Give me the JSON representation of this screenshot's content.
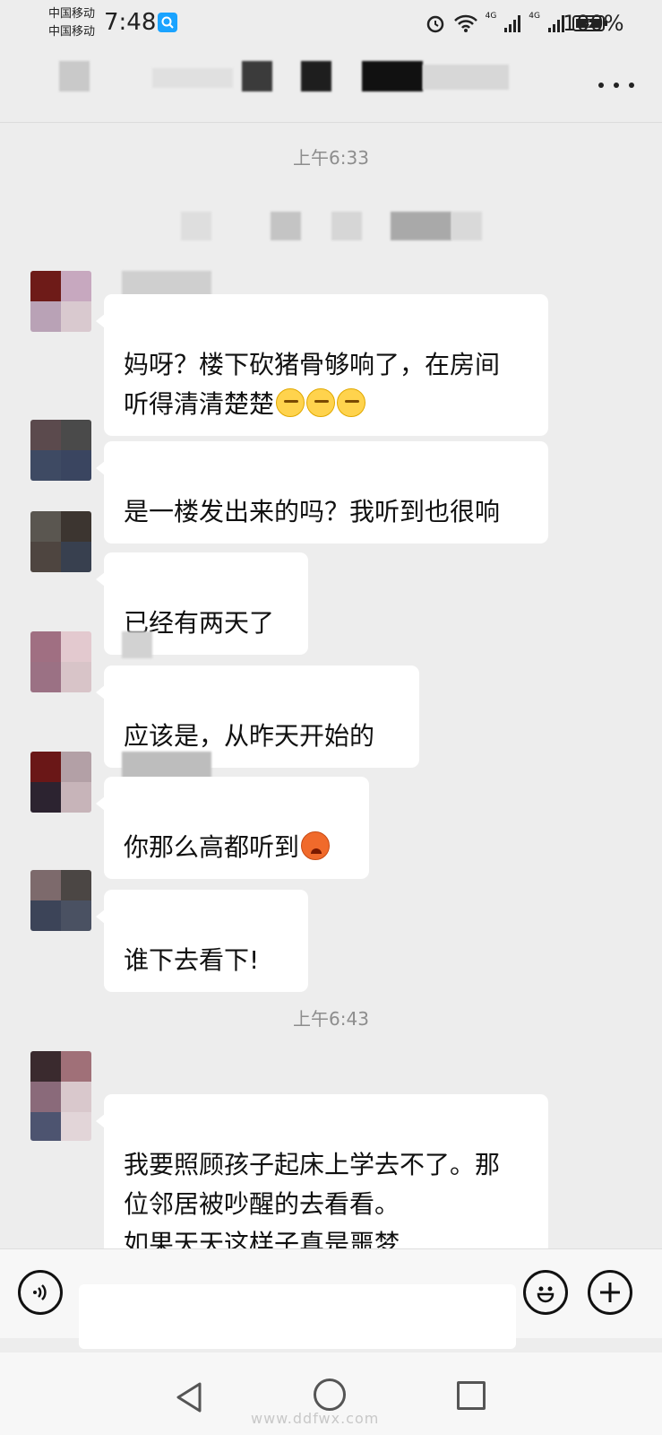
{
  "status": {
    "carrier_1": "中国移动",
    "carrier_2": "中国移动",
    "time": "7:48",
    "network_1": "4G",
    "network_2": "4G",
    "battery": "100%"
  },
  "chat": {
    "timestamps": [
      "上午6:33",
      "上午6:43"
    ],
    "messages": [
      {
        "text": "妈呀？楼下砍猪骨够响了，在房间\n听得清清楚楚",
        "emojis": [
          "sweat-emoji",
          "sweat-emoji",
          "sweat-emoji"
        ]
      },
      {
        "text": "是一楼发出来的吗？我听到也很响"
      },
      {
        "text": "已经有两天了"
      },
      {
        "text": "应该是，从昨天开始的"
      },
      {
        "text": "你那么高都听到",
        "emojis": [
          "hot-face-emoji"
        ]
      },
      {
        "text": "谁下去看下!"
      },
      {
        "text": "我要照顾孩子起床上学去不了。那\n位邻居被吵醒的去看看。\n如果天天这样子真是噩梦"
      }
    ]
  },
  "watermark": "www.ddfwx.com",
  "colors": {
    "background": "#ededed",
    "bubble": "#ffffff",
    "search_badge": "#1aa3ff"
  }
}
